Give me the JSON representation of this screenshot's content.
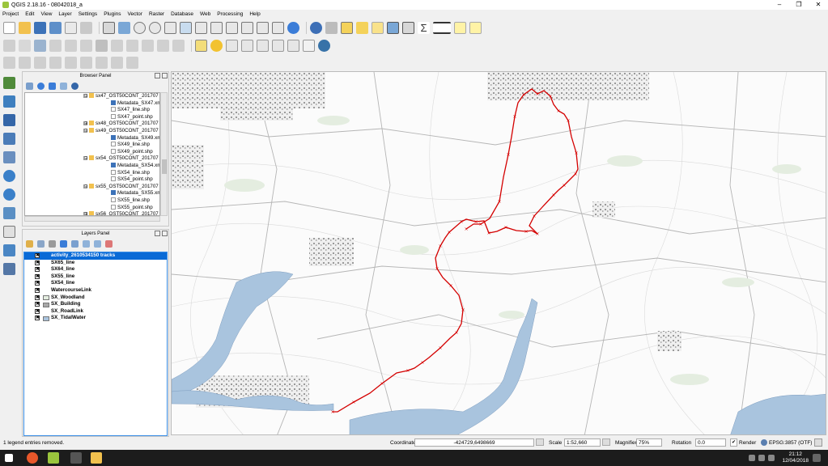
{
  "window": {
    "title": "QGIS 2.18.16 - 08042018_a",
    "minimize": "–",
    "maximize": "❐",
    "close": "✕"
  },
  "menu": [
    "Project",
    "Edit",
    "View",
    "Layer",
    "Settings",
    "Plugins",
    "Vector",
    "Raster",
    "Database",
    "Web",
    "Processing",
    "Help"
  ],
  "browser_panel": {
    "title": "Browser Panel",
    "items": [
      {
        "indent": 2,
        "type": "folder",
        "label": "sx47_OST50CONT_201707",
        "expand": "⊟"
      },
      {
        "indent": 3,
        "type": "meta",
        "label": "Metadata_SX47.xml"
      },
      {
        "indent": 3,
        "type": "line",
        "label": "SX47_line.shp"
      },
      {
        "indent": 3,
        "type": "point",
        "label": "SX47_point.shp"
      },
      {
        "indent": 2,
        "type": "folder",
        "label": "sx48_OST50CONT_201707",
        "expand": "⊞"
      },
      {
        "indent": 2,
        "type": "folder",
        "label": "sx49_OST50CONT_201707",
        "expand": "⊟"
      },
      {
        "indent": 3,
        "type": "meta",
        "label": "Metadata_SX49.xml"
      },
      {
        "indent": 3,
        "type": "line",
        "label": "SX49_line.shp"
      },
      {
        "indent": 3,
        "type": "point",
        "label": "SX49_point.shp"
      },
      {
        "indent": 2,
        "type": "folder",
        "label": "sx54_OST50CONT_201707",
        "expand": "⊟"
      },
      {
        "indent": 3,
        "type": "meta",
        "label": "Metadata_SX54.xml"
      },
      {
        "indent": 3,
        "type": "line",
        "label": "SX54_line.shp"
      },
      {
        "indent": 3,
        "type": "point",
        "label": "SX54_point.shp"
      },
      {
        "indent": 2,
        "type": "folder",
        "label": "sx55_OST50CONT_201707",
        "expand": "⊟"
      },
      {
        "indent": 3,
        "type": "meta",
        "label": "Metadata_SX55.xml"
      },
      {
        "indent": 3,
        "type": "line",
        "label": "SX55_line.shp"
      },
      {
        "indent": 3,
        "type": "point",
        "label": "SX55_point.shp"
      },
      {
        "indent": 2,
        "type": "folder",
        "label": "sx56_OST50CONT_201707",
        "expand": "⊞"
      }
    ]
  },
  "layers_panel": {
    "title": "Layers Panel",
    "layers": [
      {
        "label": "activity_2610534150 tracks",
        "checked": "✖",
        "selected": true,
        "symbol": "none"
      },
      {
        "label": "SX65_line",
        "checked": "✖",
        "selected": false,
        "symbol": "none"
      },
      {
        "label": "SX64_line",
        "checked": "✖",
        "selected": false,
        "symbol": "none"
      },
      {
        "label": "SX55_line",
        "checked": "✖",
        "selected": false,
        "symbol": "none"
      },
      {
        "label": "SX54_line",
        "checked": "✖",
        "selected": false,
        "symbol": "none"
      },
      {
        "label": "WatercourseLink",
        "checked": "✖",
        "selected": false,
        "symbol": "none"
      },
      {
        "label": "SX_Woodland",
        "checked": "✖",
        "selected": false,
        "symbol": "#e4ede0"
      },
      {
        "label": "SX_Building",
        "checked": "✖",
        "selected": false,
        "symbol": "#a8a8a8"
      },
      {
        "label": "SX_RoadLink",
        "checked": "✖",
        "selected": false,
        "symbol": "none"
      },
      {
        "label": "SX_TidalWater",
        "checked": "✖",
        "selected": false,
        "symbol": "#a9c4de"
      }
    ]
  },
  "status": {
    "message": "1 legend entries removed.",
    "coordinate_label": "Coordinate",
    "coordinate_value": "-424729,6498669",
    "scale_label": "Scale",
    "scale_value": "1:52,660",
    "magnifier_label": "Magnifier",
    "magnifier_value": "75%",
    "rotation_label": "Rotation",
    "rotation_value": "0.0",
    "render_label": "Render",
    "render_checked": "✔",
    "crs_label": "EPSG:3857 (OTF)"
  },
  "taskbar": {
    "time": "21:12",
    "date": "12/04/2018"
  },
  "colors": {
    "track": "#d40000",
    "water": "#a9c4de",
    "woodland": "#e4ede0",
    "building": "#a8a8a8",
    "selection": "#0a6ad6"
  }
}
